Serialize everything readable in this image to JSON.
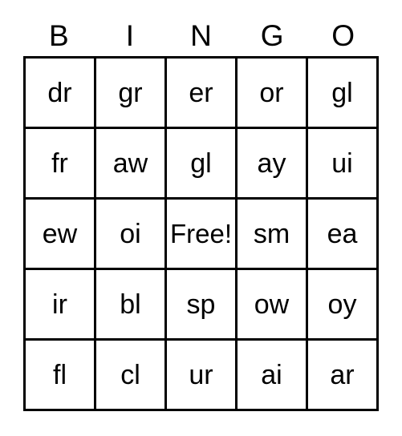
{
  "card": {
    "headers": [
      "B",
      "I",
      "N",
      "G",
      "O"
    ],
    "rows": [
      {
        "cells": [
          {
            "text": "dr",
            "free": false
          },
          {
            "text": "gr",
            "free": false
          },
          {
            "text": "er",
            "free": false
          },
          {
            "text": "or",
            "free": false
          },
          {
            "text": "gl",
            "free": false
          }
        ]
      },
      {
        "cells": [
          {
            "text": "fr",
            "free": false
          },
          {
            "text": "aw",
            "free": false
          },
          {
            "text": "gl",
            "free": false
          },
          {
            "text": "ay",
            "free": false
          },
          {
            "text": "ui",
            "free": false
          }
        ]
      },
      {
        "cells": [
          {
            "text": "ew",
            "free": false
          },
          {
            "text": "oi",
            "free": false
          },
          {
            "text": "Free!",
            "free": true
          },
          {
            "text": "sm",
            "free": false
          },
          {
            "text": "ea",
            "free": false
          }
        ]
      },
      {
        "cells": [
          {
            "text": "ir",
            "free": false
          },
          {
            "text": "bl",
            "free": false
          },
          {
            "text": "sp",
            "free": false
          },
          {
            "text": "ow",
            "free": false
          },
          {
            "text": "oy",
            "free": false
          }
        ]
      },
      {
        "cells": [
          {
            "text": "fl",
            "free": false
          },
          {
            "text": "cl",
            "free": false
          },
          {
            "text": "ur",
            "free": false
          },
          {
            "text": "ai",
            "free": false
          },
          {
            "text": "ar",
            "free": false
          }
        ]
      }
    ],
    "colors": {
      "border": "#000000",
      "text": "#000000",
      "background": "#ffffff"
    }
  }
}
